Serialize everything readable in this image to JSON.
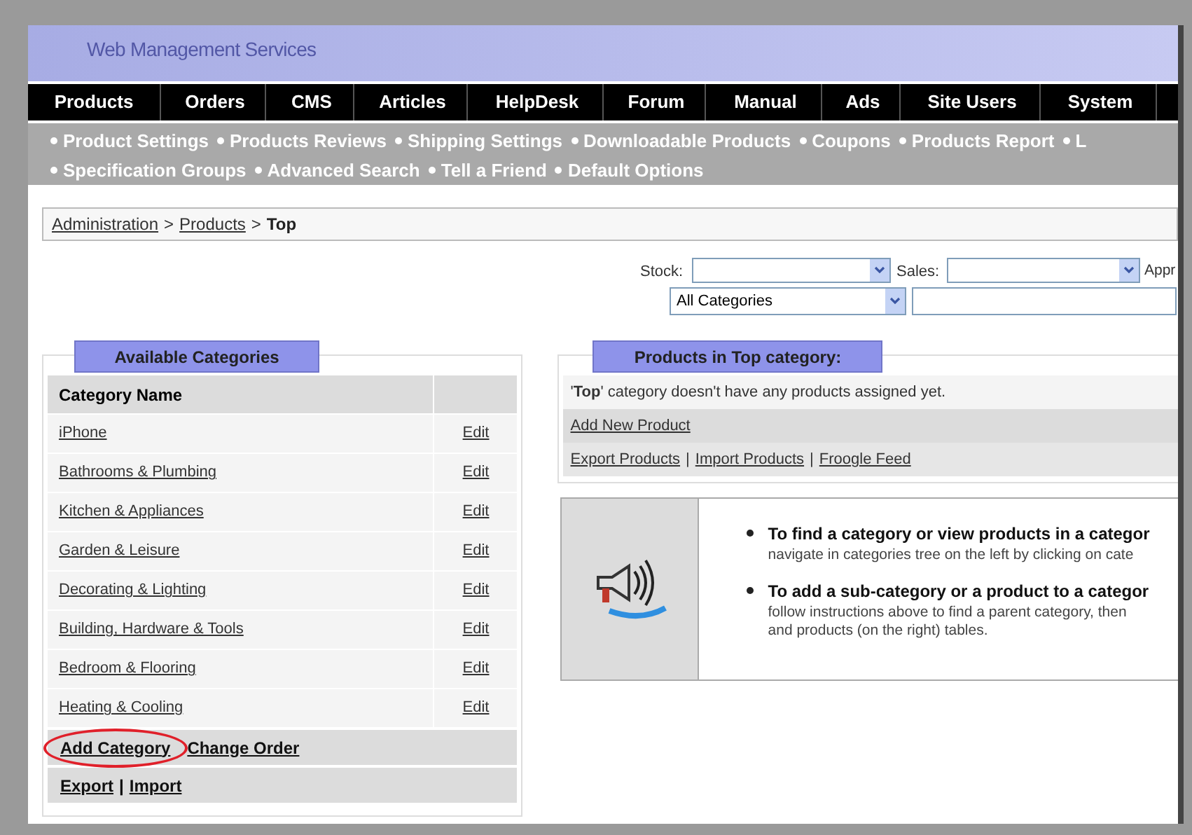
{
  "header": {
    "title": "Web Management Services"
  },
  "nav": [
    {
      "label": "Products"
    },
    {
      "label": "Orders"
    },
    {
      "label": "CMS"
    },
    {
      "label": "Articles"
    },
    {
      "label": "HelpDesk"
    },
    {
      "label": "Forum"
    },
    {
      "label": "Manual"
    },
    {
      "label": "Ads"
    },
    {
      "label": "Site Users"
    },
    {
      "label": "System"
    }
  ],
  "sub_nav": [
    [
      "Product Settings",
      "Products Reviews",
      "Shipping Settings",
      "Downloadable Products",
      "Coupons",
      "Products Report",
      "L"
    ],
    [
      "Specification Groups",
      "Advanced Search",
      "Tell a Friend",
      "Default Options"
    ]
  ],
  "breadcrumb": [
    {
      "label": "Administration",
      "link": true
    },
    {
      "label": "Products",
      "link": true
    },
    {
      "label": "Top",
      "link": false
    }
  ],
  "separator": ">",
  "link_separator": "|",
  "filters": {
    "stock_label": "Stock:",
    "sales_label": "Sales:",
    "cut_label": "Appr",
    "category_select": "All Categories"
  },
  "categories_panel": {
    "legend": "Available Categories",
    "column": "Category Name",
    "rows": [
      {
        "name": "iPhone",
        "action": "Edit"
      },
      {
        "name": "Bathrooms & Plumbing",
        "action": "Edit"
      },
      {
        "name": "Kitchen & Appliances",
        "action": "Edit"
      },
      {
        "name": "Garden & Leisure",
        "action": "Edit"
      },
      {
        "name": "Decorating & Lighting",
        "action": "Edit"
      },
      {
        "name": "Building, Hardware & Tools",
        "action": "Edit"
      },
      {
        "name": "Bedroom & Flooring",
        "action": "Edit"
      },
      {
        "name": "Heating & Cooling",
        "action": "Edit"
      }
    ],
    "footer": [
      [
        {
          "label": "Add Category",
          "circled": true
        },
        {
          "label": "Change Order",
          "circled": false
        }
      ],
      [
        {
          "label": "Export",
          "circled": false
        },
        {
          "label": "Import",
          "circled": false
        }
      ]
    ]
  },
  "products_panel": {
    "legend": "Products in Top category:",
    "message": "'**Top**' category doesn't have any products assigned yet.",
    "add_link": "Add New Product",
    "links": [
      "Export Products",
      "Import Products",
      "Froogle Feed"
    ]
  },
  "tips": [
    {
      "title": "To find a category or view products in a categor",
      "lines": [
        "navigate in categories tree on the left by clicking on cate"
      ]
    },
    {
      "title": "To add a sub-category or a product to a categor",
      "lines": [
        "follow instructions above to find a parent category, then",
        "and products (on the right) tables."
      ]
    }
  ]
}
